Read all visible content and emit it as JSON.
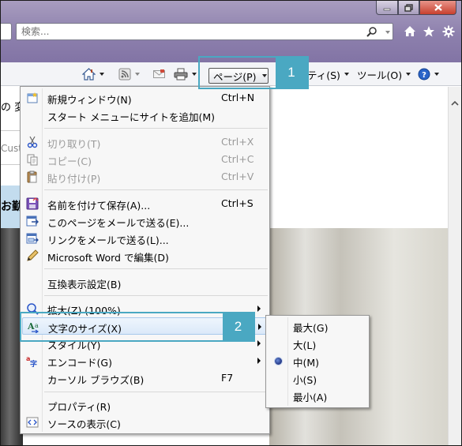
{
  "browser": {
    "search_placeholder": "検索..."
  },
  "command_bar": {
    "page_label": "ページ(P)",
    "safety_label": "ティ(S)",
    "tools_label": "ツール(O)"
  },
  "background_page": {
    "text_top": "の 変",
    "text_field": "Cust",
    "text_strip": "お勤"
  },
  "callouts": [
    "1",
    "2"
  ],
  "page_menu": {
    "items": [
      {
        "label": "新規ウィンドウ(N)",
        "shortcut": "Ctrl+N",
        "icon": "new-window-icon",
        "enabled": true
      },
      {
        "label": "スタート メニューにサイトを追加(M)",
        "shortcut": "",
        "icon": "",
        "enabled": true
      },
      {
        "label": "切り取り(T)",
        "shortcut": "Ctrl+X",
        "icon": "scissors-icon",
        "enabled": false
      },
      {
        "label": "コピー(C)",
        "shortcut": "Ctrl+C",
        "icon": "copy-icon",
        "enabled": false
      },
      {
        "label": "貼り付け(P)",
        "shortcut": "Ctrl+V",
        "icon": "paste-icon",
        "enabled": false
      },
      {
        "label": "名前を付けて保存(A)...",
        "shortcut": "Ctrl+S",
        "icon": "save-icon",
        "enabled": true
      },
      {
        "label": "このページをメールで送る(E)...",
        "shortcut": "",
        "icon": "mail-page-icon",
        "enabled": true
      },
      {
        "label": "リンクをメールで送る(L)...",
        "shortcut": "",
        "icon": "mail-link-icon",
        "enabled": true
      },
      {
        "label": "Microsoft Word で編集(D)",
        "shortcut": "",
        "icon": "pencil-icon",
        "enabled": true
      },
      {
        "label": "互換表示設定(B)",
        "shortcut": "",
        "icon": "",
        "enabled": true
      },
      {
        "label": "拡大(Z) (100%)",
        "shortcut": "",
        "icon": "zoom-icon",
        "enabled": true,
        "submenu": true
      },
      {
        "label": "文字のサイズ(X)",
        "shortcut": "",
        "icon": "text-size-icon",
        "enabled": true,
        "submenu": true,
        "highlighted": true
      },
      {
        "label": "スタイル(Y)",
        "shortcut": "",
        "icon": "",
        "enabled": true,
        "submenu": true
      },
      {
        "label": "エンコード(G)",
        "shortcut": "",
        "icon": "encoding-icon",
        "enabled": true,
        "submenu": true
      },
      {
        "label": "カーソル ブラウズ(B)",
        "shortcut": "F7",
        "icon": "",
        "enabled": true
      },
      {
        "label": "プロパティ(R)",
        "shortcut": "",
        "icon": "",
        "enabled": true
      },
      {
        "label": "ソースの表示(C)",
        "shortcut": "",
        "icon": "view-source-icon",
        "enabled": true
      }
    ]
  },
  "text_size_menu": {
    "items": [
      {
        "label": "最大(G)",
        "selected": false
      },
      {
        "label": "大(L)",
        "selected": false
      },
      {
        "label": "中(M)",
        "selected": true
      },
      {
        "label": "小(S)",
        "selected": false
      },
      {
        "label": "最小(A)",
        "selected": false
      }
    ]
  },
  "colors": {
    "titlebar": "#8d80ad",
    "callout": "#4aa8c2",
    "menu_bg": "#f7f7f7",
    "highlight_border": "#a8c9ec"
  }
}
